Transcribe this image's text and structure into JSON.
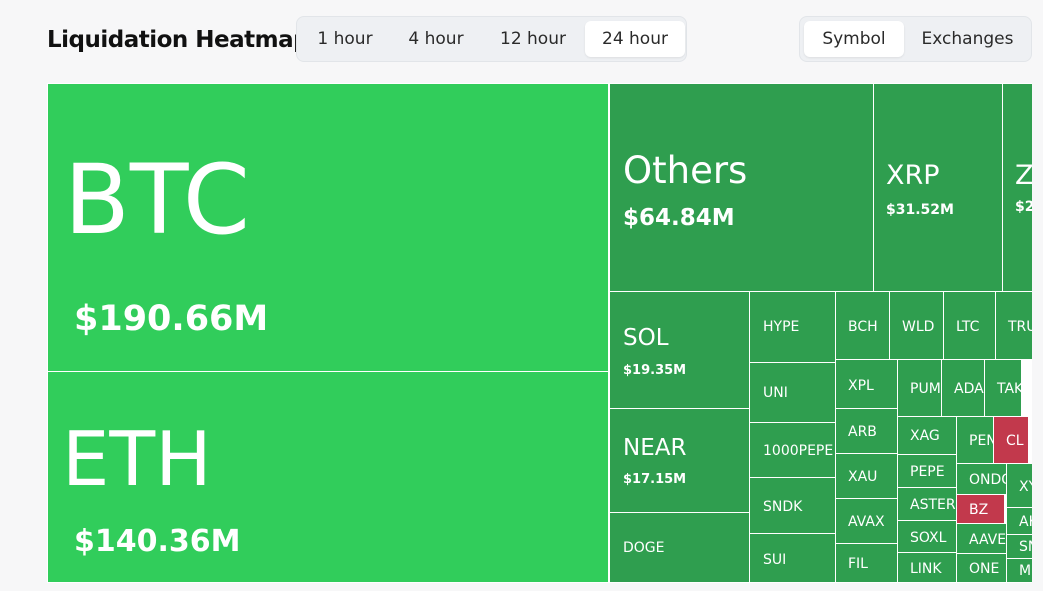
{
  "page": {
    "title": "Liquidation Heatmap"
  },
  "time_filter": {
    "options": [
      "1 hour",
      "4 hour",
      "12 hour",
      "24 hour"
    ],
    "selected": "24 hour"
  },
  "group_filter": {
    "options": [
      "Symbol",
      "Exchanges"
    ],
    "selected": "Symbol"
  },
  "colors": {
    "large": "#31cd5b",
    "green": "#2f9e4f",
    "red": "#c2394c"
  },
  "tiles": [
    {
      "symbol": "BTC",
      "value": "$190.66M",
      "color": "large"
    },
    {
      "symbol": "ETH",
      "value": "$140.36M",
      "color": "large"
    },
    {
      "symbol": "Others",
      "value": "$64.84M",
      "color": "green"
    },
    {
      "symbol": "XRP",
      "value": "$31.52M",
      "color": "green"
    },
    {
      "symbol": "Z",
      "value": "$2",
      "color": "green"
    },
    {
      "symbol": "SOL",
      "value": "$19.35M",
      "color": "green"
    },
    {
      "symbol": "NEAR",
      "value": "$17.15M",
      "color": "green"
    },
    {
      "symbol": "DOGE",
      "value": "",
      "color": "green"
    },
    {
      "symbol": "HYPE",
      "value": "",
      "color": "green"
    },
    {
      "symbol": "UNI",
      "value": "",
      "color": "green"
    },
    {
      "symbol": "1000PEPE",
      "value": "",
      "color": "green"
    },
    {
      "symbol": "SNDK",
      "value": "",
      "color": "green"
    },
    {
      "symbol": "SUI",
      "value": "",
      "color": "green"
    },
    {
      "symbol": "BCH",
      "value": "",
      "color": "green"
    },
    {
      "symbol": "WLD",
      "value": "",
      "color": "green"
    },
    {
      "symbol": "LTC",
      "value": "",
      "color": "green"
    },
    {
      "symbol": "TRU",
      "value": "",
      "color": "green"
    },
    {
      "symbol": "XPL",
      "value": "",
      "color": "green"
    },
    {
      "symbol": "ARB",
      "value": "",
      "color": "green"
    },
    {
      "symbol": "XAU",
      "value": "",
      "color": "green"
    },
    {
      "symbol": "AVAX",
      "value": "",
      "color": "green"
    },
    {
      "symbol": "FIL",
      "value": "",
      "color": "green"
    },
    {
      "symbol": "PUM",
      "value": "",
      "color": "green"
    },
    {
      "symbol": "ADA",
      "value": "",
      "color": "green"
    },
    {
      "symbol": "TAK",
      "value": "",
      "color": "green"
    },
    {
      "symbol": "XAG",
      "value": "",
      "color": "green"
    },
    {
      "symbol": "PEPE",
      "value": "",
      "color": "green"
    },
    {
      "symbol": "ASTER",
      "value": "",
      "color": "green"
    },
    {
      "symbol": "SOXL",
      "value": "",
      "color": "green"
    },
    {
      "symbol": "LINK",
      "value": "",
      "color": "green"
    },
    {
      "symbol": "PEN",
      "value": "",
      "color": "green"
    },
    {
      "symbol": "CL",
      "value": "",
      "color": "red"
    },
    {
      "symbol": "ONDO",
      "value": "",
      "color": "green"
    },
    {
      "symbol": "XY",
      "value": "",
      "color": "green"
    },
    {
      "symbol": "BZ",
      "value": "",
      "color": "red"
    },
    {
      "symbol": "AAVE",
      "value": "",
      "color": "green"
    },
    {
      "symbol": "AK",
      "value": "",
      "color": "green"
    },
    {
      "symbol": "ONE",
      "value": "",
      "color": "green"
    },
    {
      "symbol": "SN",
      "value": "",
      "color": "green"
    },
    {
      "symbol": "MI",
      "value": "",
      "color": "green"
    }
  ]
}
